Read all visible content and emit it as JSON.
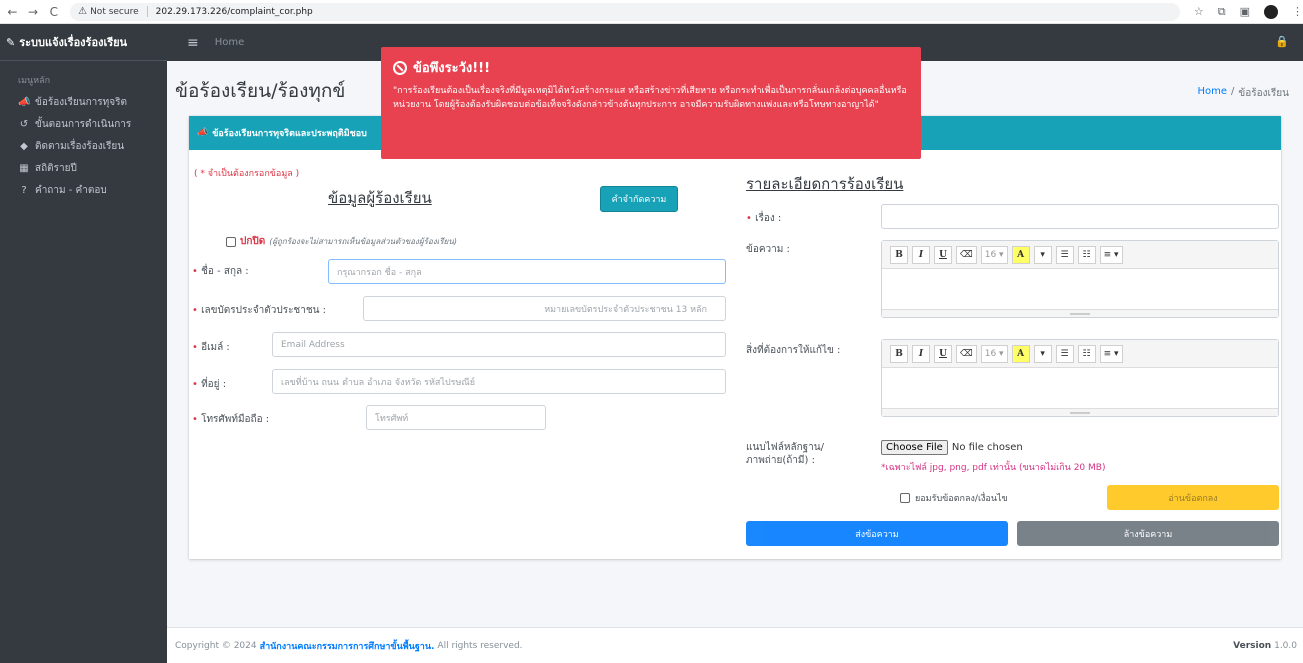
{
  "browser": {
    "not_secure": "Not secure",
    "url": "202.29.173.226/complaint_cor.php"
  },
  "sidebar": {
    "brand": "ระบบแจ้งเรื่องร้องเรียน",
    "menu_header": "เมนูหลัก",
    "items": [
      {
        "label": "ข้อร้องเรียนการทุจริต",
        "icon": "bullhorn-icon"
      },
      {
        "label": "ขั้นตอนการดำเนินการ",
        "icon": "history-icon"
      },
      {
        "label": "ติดตามเรื่องร้องเรียน",
        "icon": "tags-icon"
      },
      {
        "label": "สถิติรายปี",
        "icon": "chart-icon"
      },
      {
        "label": "คำถาม - คำตอบ",
        "icon": "question-icon"
      }
    ]
  },
  "topnav": {
    "home": "Home"
  },
  "page": {
    "title": "ข้อร้องเรียน/ร้องทุกข์",
    "breadcrumb_home": "Home",
    "breadcrumb_sep": "/",
    "breadcrumb_current": "ข้อร้องเรียน"
  },
  "card": {
    "header": "ข้อร้องเรียนการทุจริตและประพฤติมิชอบ"
  },
  "form": {
    "required_note": "( * จำเป็นต้องกรอกข้อมูล )",
    "left_title": "ข้อมูลผู้ร้องเรียน",
    "define_button": "คำจำกัดความ",
    "anonymous_label": "ปกปิด",
    "anonymous_hint": "(ผู้ถูกร้องจะไม่สามารถเห็นข้อมูลส่วนตัวของผู้ร้องเรียน)",
    "name_label": "ชื่อ - สกุล :",
    "name_placeholder": "กรุณากรอก ชื่อ - สกุล",
    "id_label": "เลขบัตรประจำตัวประชาชน :",
    "id_placeholder": "หมายเลขบัตรประจำตัวประชาชน 13 หลัก",
    "email_label": "อีเมล์ :",
    "email_placeholder": "Email Address",
    "address_label": "ที่อยู่ :",
    "address_placeholder": "เลขที่บ้าน ถนน ตำบล อำเภอ จังหวัด รหัสไปรษณีย์",
    "phone_label": "โทรศัพท์มือถือ :",
    "phone_placeholder": "โทรศัพท์",
    "right_title": "รายละเอียดการร้องเรียน",
    "subject_label": "เรื่อง :",
    "message_label": "ข้อความ :",
    "request_label": "สิ่งที่ต้องการให้แก้ไข :",
    "attach_label_1": "แนบไฟล์หลักฐาน/",
    "attach_label_2": "ภาพถ่าย(ถ้ามี) :",
    "choose_file": "Choose File",
    "no_file": "No file chosen",
    "file_hint": "*เฉพาะไฟล์ jpg, png, pdf เท่านั้น (ขนาดไม่เกิน 20 MB)",
    "accept_label": "ยอมรับข้อตกลง/เงื่อนไข",
    "read_terms": "อ่านข้อตกลง",
    "submit": "ส่งข้อความ",
    "clear": "ล้างข้อความ"
  },
  "toolbar": {
    "bold": "B",
    "italic": "I",
    "underline": "U",
    "eraser": "⌫",
    "size": "16 ▾",
    "highlight": "A",
    "caret": "▾",
    "ul": "☰",
    "ol": "☷",
    "align": "≡ ▾"
  },
  "alert": {
    "title": "ข้อพึงระวัง!!!",
    "body": "\"การร้องเรียนต้องเป็นเรื่องจริงที่มีมูลเหตุมิได้หวังสร้างกระแส หรือสร้างข่าวที่เสียหาย หรือกระทำเพื่อเป็นการกลั่นแกล้งต่อบุคคลอื่นหรือหน่วยงาน โดยผู้ร้องต้องรับผิดชอบต่อข้อเท็จจริงดังกล่าวข้างต้นทุกประการ อาจมีความรับผิดทางแพ่งและหรือโทษทางอาญาได้\""
  },
  "footer": {
    "copyright": "Copyright © 2024",
    "org": "สำนักงานคณะกรรมการการศึกษาขั้นพื้นฐาน.",
    "rights": "All rights reserved.",
    "version_label": "Version",
    "version": "1.0.0"
  },
  "colors": {
    "sidebar": "#343a40",
    "card_header": "#17a2b8",
    "alert": "#e8414f",
    "primary": "#007bff",
    "warning": "#ffc107"
  }
}
